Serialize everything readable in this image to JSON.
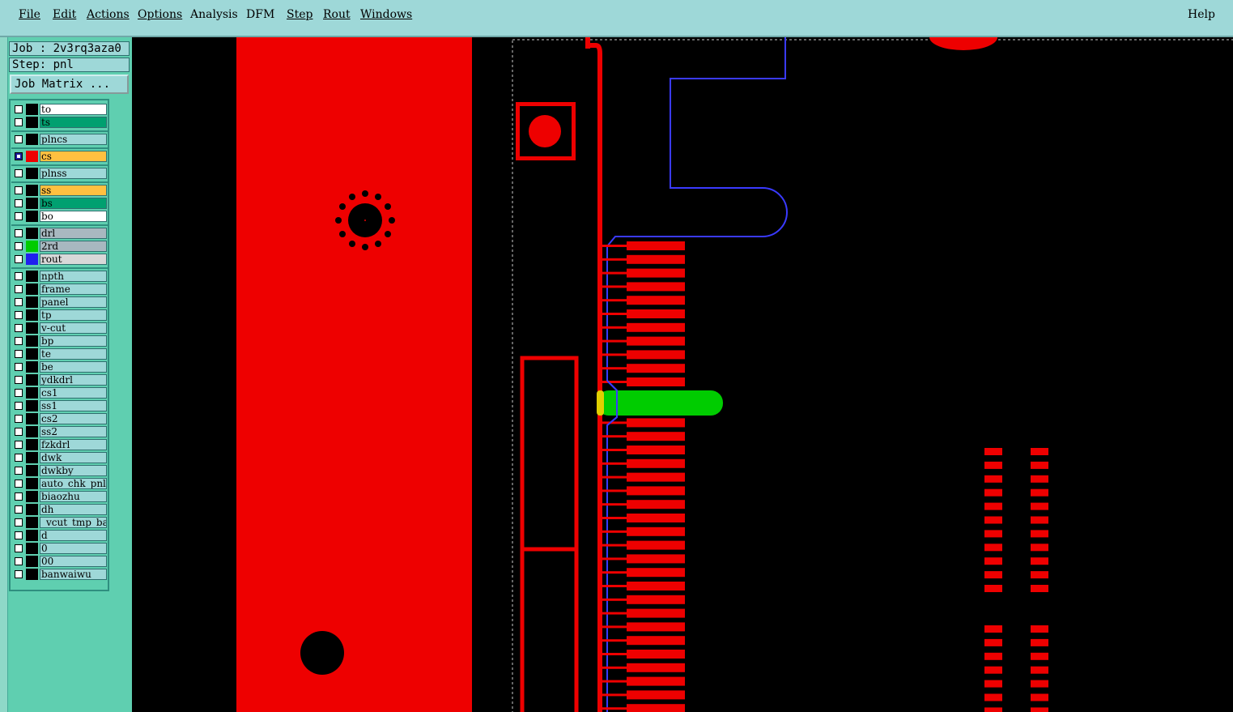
{
  "menu": {
    "file": "File",
    "edit": "Edit",
    "actions": "Actions",
    "options": "Options",
    "analysis": "Analysis",
    "dfm": "DFM",
    "step": "Step",
    "rout": "Rout",
    "windows": "Windows",
    "help": "Help"
  },
  "info": {
    "job": "Job : 2v3rq3aza0",
    "step": "Step: pnl",
    "job_matrix": "Job Matrix ..."
  },
  "layers": {
    "to": "to",
    "ts": "ts",
    "plncs": "plncs",
    "cs": "cs",
    "plnss": "plnss",
    "ss": "ss",
    "bs": "bs",
    "bo": "bo",
    "drl": "drl",
    "rd2": "2rd",
    "rout": "rout",
    "npth": "npth",
    "frame": "frame",
    "panel": "panel",
    "tp": "tp",
    "vcut": "v-cut",
    "bp": "bp",
    "te": "te",
    "be": "be",
    "ydkdrl": "ydkdrl",
    "cs1": "cs1",
    "ss1": "ss1",
    "cs2": "cs2",
    "ss2": "ss2",
    "fzkdrl": "fzkdrl",
    "dwk": "dwk",
    "dwkby": "dwkby",
    "auto_chk": "auto_chk_pnl",
    "biaozhu": "biaozhu",
    "dh": "dh",
    "vcut_tmp": "_vcut_tmp_ba",
    "d": "d",
    "zero": "0",
    "zerozero": "00",
    "banwaiwu": "banwaiwu"
  },
  "colors": {
    "copper": "#ee0000",
    "rout": "#3030ff",
    "drill_green": "#00cc00",
    "menu_bg": "#9ed8d8",
    "panel_bg": "#5fcfb0"
  }
}
